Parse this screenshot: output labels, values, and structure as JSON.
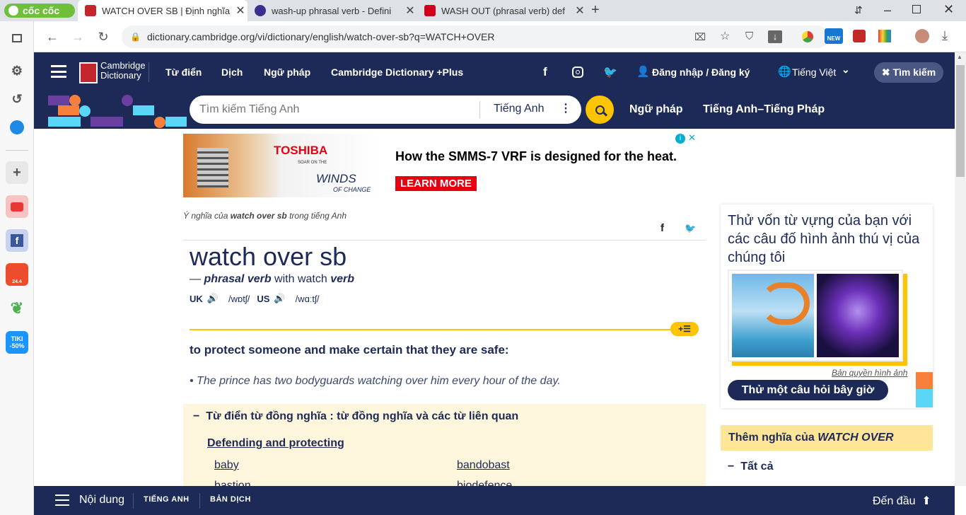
{
  "browser": {
    "tabs": [
      {
        "label": "WATCH OVER SB | Định nghĩa",
        "favicon_color": "#c4262e",
        "active": true
      },
      {
        "label": "wash-up phrasal verb - Defini",
        "favicon_color": "#3a2f8f",
        "active": false
      },
      {
        "label": "WASH OUT (phrasal verb) def",
        "favicon_color": "#d0021b",
        "active": false
      }
    ],
    "brand": "cốc cốc",
    "url": "dictionary.cambridge.org/vi/dictionary/english/watch-over-sb?q=WATCH+OVER",
    "new_badge": "NEW"
  },
  "sidebar": {
    "items": [
      {
        "icon": "panel-icon"
      },
      {
        "icon": "settings-icon"
      },
      {
        "icon": "history-icon"
      },
      {
        "icon": "messenger-icon"
      },
      {
        "icon": "add-icon"
      },
      {
        "icon": "youtube-icon"
      },
      {
        "icon": "facebook-icon"
      },
      {
        "icon": "shopee-icon",
        "text": "24.4"
      },
      {
        "icon": "leaf-icon"
      },
      {
        "icon": "tiki-icon",
        "text": "TIKI -50%"
      }
    ]
  },
  "nav": {
    "logo_line1": "Cambridge",
    "logo_line2": "Dictionary",
    "items": [
      "Từ điển",
      "Dịch",
      "Ngữ pháp",
      "Cambridge Dictionary +Plus"
    ],
    "login": "Đăng nhập / Đăng ký",
    "language": "Tiếng Việt",
    "search_toggle": "Tìm kiếm"
  },
  "search": {
    "placeholder": "Tìm kiếm Tiếng Anh",
    "dictionary": "Tiếng Anh",
    "link1": "Ngữ pháp",
    "link2": "Tiếng Anh–Tiếng Pháp"
  },
  "ad": {
    "brand": "TOSHIBA",
    "tag1": "SOAR ON THE",
    "tag2": "WINDS",
    "tag3": "OF CHANGE",
    "headline": "How the SMMS-7 VRF is designed for the heat.",
    "cta": "LEARN MORE"
  },
  "entry": {
    "meaning_prefix": "Ý nghĩa của ",
    "meaning_word": "watch over sb",
    "meaning_suffix": " trong tiếng Anh",
    "headword": "watch over sb",
    "dash": "— ",
    "pos": "phrasal verb",
    "with": " with watch ",
    "pos2": "verb",
    "uk": "UK",
    "uk_ipa": "/wɒtʃ/",
    "us": "US",
    "us_ipa": "/wɑːtʃ/",
    "definition": "to protect someone and make certain that they are safe:",
    "example": "The prince has two bodyguards watching over him every hour of the day.",
    "thesaurus_title": "Từ điển từ đồng nghĩa : từ đồng nghĩa và các từ liên quan",
    "thesaurus_group": "Defending and protecting",
    "words": [
      "baby",
      "bandobast",
      "bastion",
      "biodefence"
    ]
  },
  "quiz": {
    "title": "Thử vốn từ vựng của bạn với các câu đố hình ảnh thú vị của chúng tôi",
    "credit": "Bản quyền hình ảnh",
    "cta": "Thử một câu hỏi bây giờ"
  },
  "more": {
    "prefix": "Thêm nghĩa của ",
    "word": "WATCH OVER",
    "all": "Tất cả"
  },
  "bottom": {
    "contents": "Nội dung",
    "tab1": "TIẾNG ANH",
    "tab2": "BẢN DỊCH",
    "top": "Đến đầu"
  }
}
